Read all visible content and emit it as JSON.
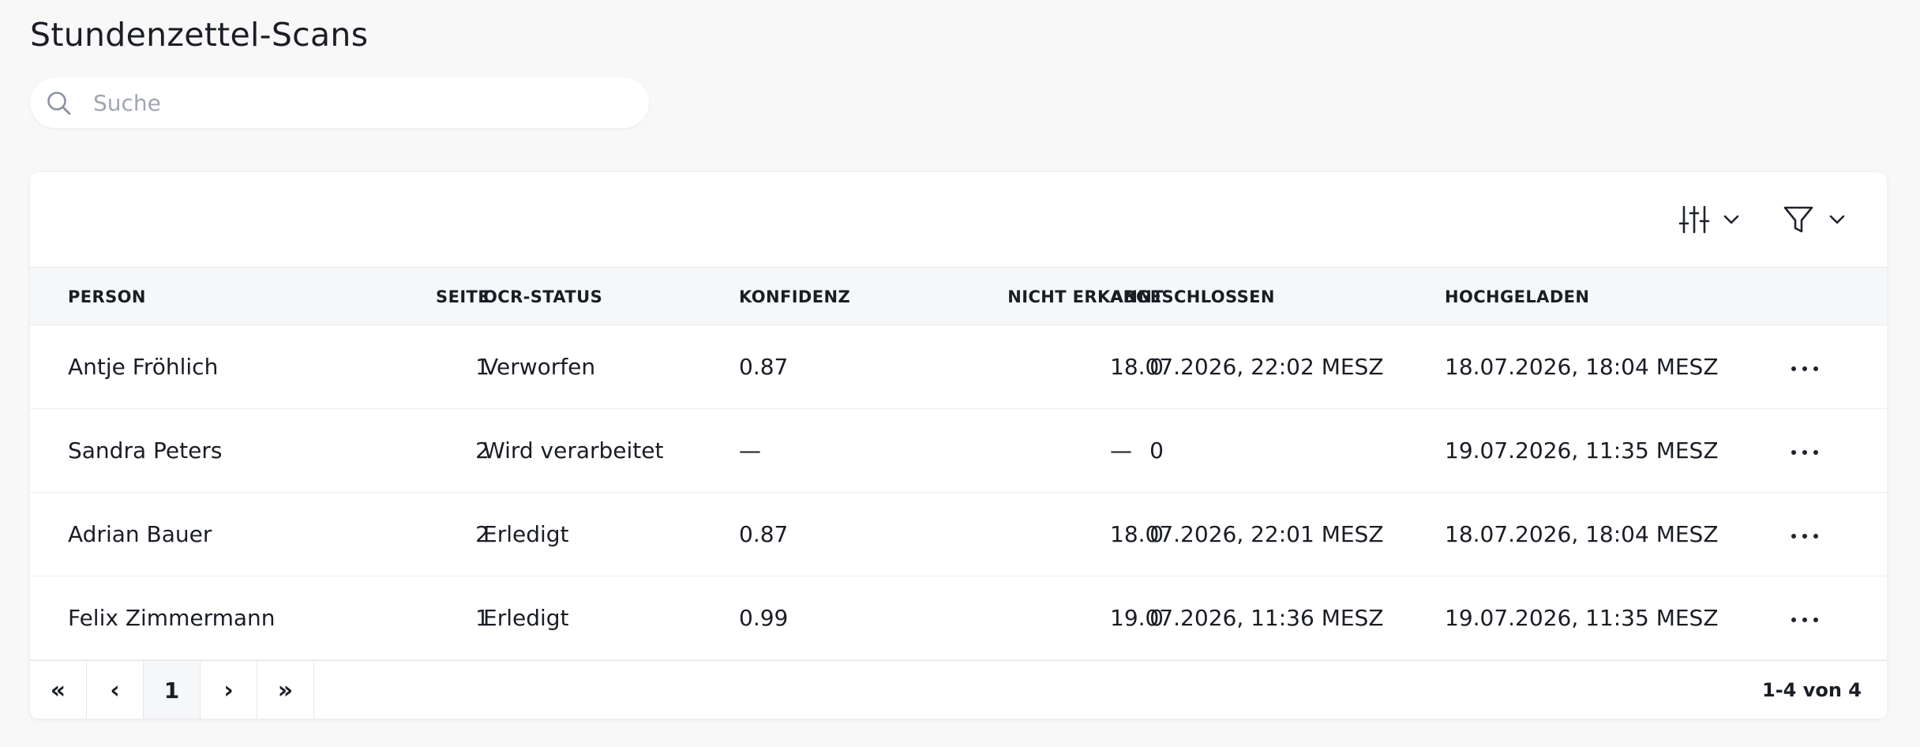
{
  "page": {
    "title": "Stundenzettel-Scans"
  },
  "search": {
    "placeholder": "Suche",
    "value": ""
  },
  "toolbar": {
    "columns_icon": "sliders-icon",
    "filter_icon": "filter-icon"
  },
  "table": {
    "headers": [
      "PERSON",
      "SEITE",
      "OCR-STATUS",
      "KONFIDENZ",
      "NICHT ERKANNT",
      "ABGESCHLOSSEN",
      "HOCHGELADEN"
    ],
    "rows": [
      {
        "person": "Antje Fröhlich",
        "seite": "1",
        "status": "Verworfen",
        "konfidenz": "0.87",
        "nicht_erkannt": "0",
        "abgeschlossen": "18.07.2026, 22:02 MESZ",
        "hochgeladen": "18.07.2026, 18:04 MESZ"
      },
      {
        "person": "Sandra Peters",
        "seite": "2",
        "status": "Wird verarbeitet",
        "konfidenz": "—",
        "nicht_erkannt": "0",
        "abgeschlossen": "—",
        "hochgeladen": "19.07.2026, 11:35 MESZ"
      },
      {
        "person": "Adrian Bauer",
        "seite": "2",
        "status": "Erledigt",
        "konfidenz": "0.87",
        "nicht_erkannt": "0",
        "abgeschlossen": "18.07.2026, 22:01 MESZ",
        "hochgeladen": "18.07.2026, 18:04 MESZ"
      },
      {
        "person": "Felix Zimmermann",
        "seite": "1",
        "status": "Erledigt",
        "konfidenz": "0.99",
        "nicht_erkannt": "0",
        "abgeschlossen": "19.07.2026, 11:36 MESZ",
        "hochgeladen": "19.07.2026, 11:35 MESZ"
      }
    ]
  },
  "pagination": {
    "first": "«",
    "prev": "‹",
    "current": "1",
    "next": "›",
    "last": "»",
    "info": "1-4 von 4"
  }
}
